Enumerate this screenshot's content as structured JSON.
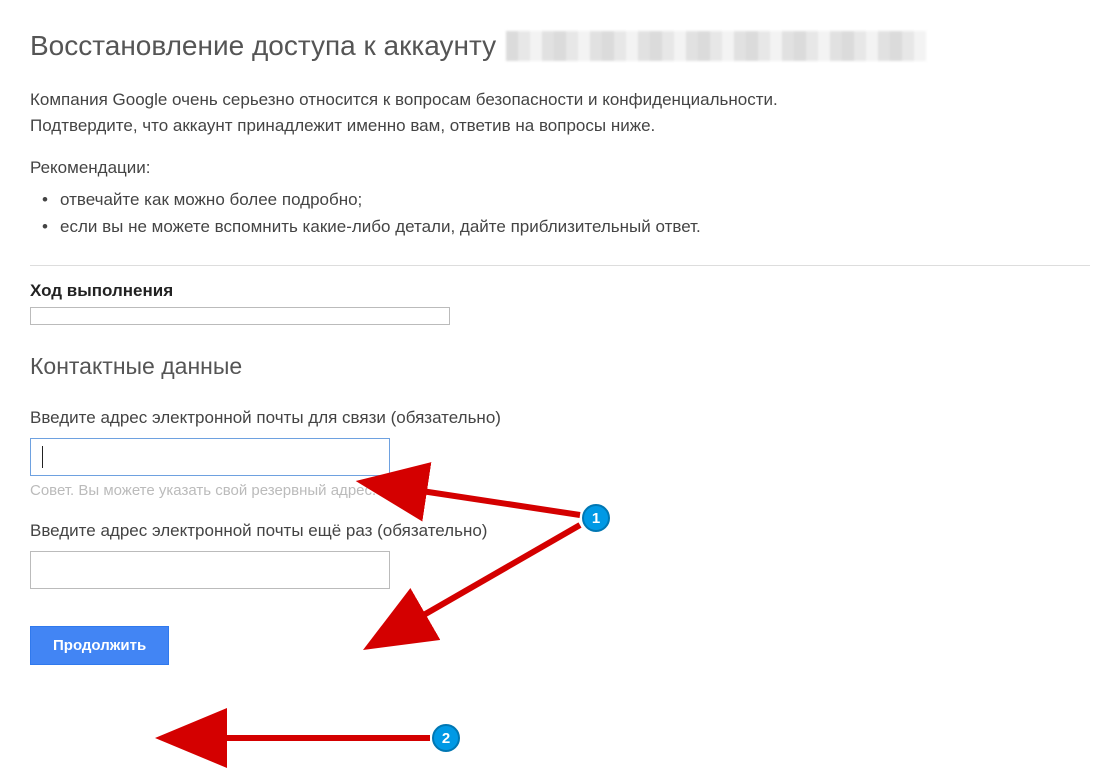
{
  "header": {
    "title": "Восстановление доступа к аккаунту"
  },
  "intro": {
    "line1": "Компания Google очень серьезно относится к вопросам безопасности и конфиденциальности.",
    "line2": "Подтвердите, что аккаунт принадлежит именно вам, ответив на вопросы ниже."
  },
  "recommendations": {
    "label": "Рекомендации:",
    "items": [
      "отвечайте как можно более подробно;",
      "если вы не можете вспомнить какие-либо детали, дайте приблизительный ответ."
    ]
  },
  "progress": {
    "label": "Ход выполнения"
  },
  "contact": {
    "title": "Контактные данные",
    "email_label": "Введите адрес электронной почты для связи (обязательно)",
    "email_value": "",
    "hint": "Совет. Вы можете указать свой резервный адрес.",
    "email_confirm_label": "Введите адрес электронной почты ещё раз (обязательно)",
    "email_confirm_value": ""
  },
  "buttons": {
    "continue": "Продолжить"
  },
  "annotations": {
    "callout1": "1",
    "callout2": "2"
  }
}
